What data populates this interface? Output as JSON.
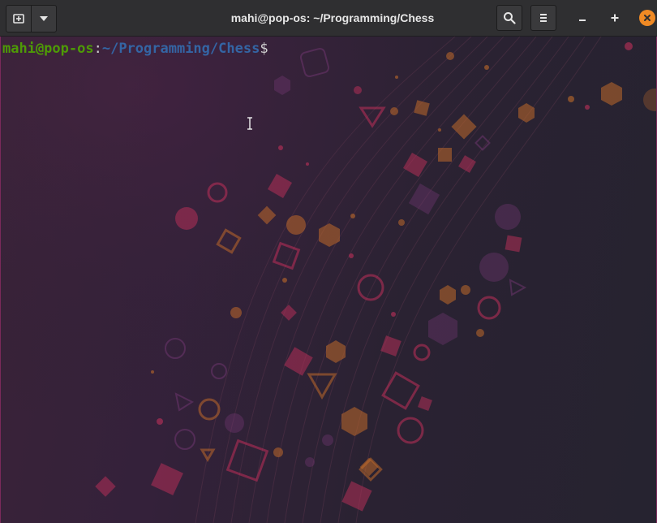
{
  "window": {
    "title": "mahi@pop-os: ~/Programming/Chess"
  },
  "header_buttons": {
    "new_tab_icon": "new-tab-icon",
    "menu_dropdown_icon": "chevron-down-icon",
    "search_icon": "search-icon",
    "hamburger_icon": "hamburger-menu-icon",
    "minimize_label": "–",
    "maximize_label": "+",
    "close_label": "×"
  },
  "terminal": {
    "user_host": "mahi@pop-os",
    "colon": ":",
    "path": "~/Programming/Chess",
    "dollar": "$"
  },
  "colors": {
    "titlebar": "#2f2f31",
    "close_button": "#f08a24",
    "prompt_user": "#4e9a06",
    "prompt_path": "#3465a4"
  }
}
